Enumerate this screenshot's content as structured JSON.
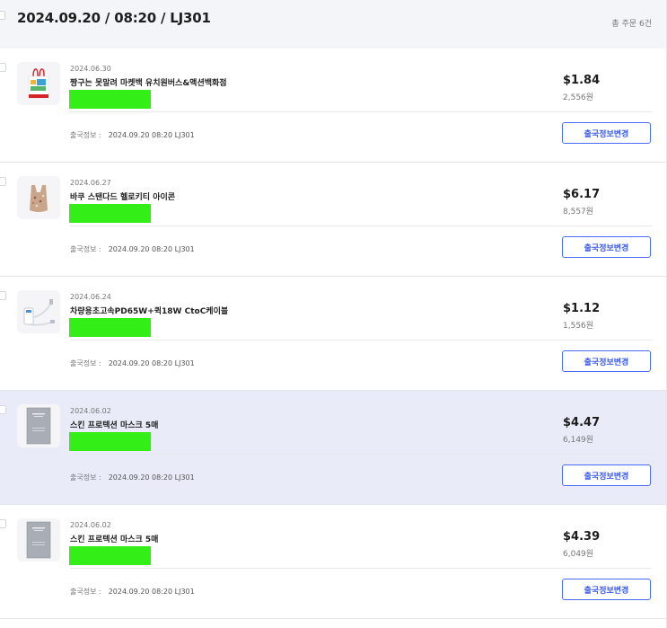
{
  "header": {
    "title": "2024.09.20 / 08:20 / LJ301",
    "total_orders": "총 주문 6건"
  },
  "ship_label": "출국정보 :",
  "ship_button_label": "출국정보변경",
  "items": [
    {
      "date": "2024.06.30",
      "name": "짱구는 못말려 마켓백 유치원버스&액션백화점",
      "price_usd": "$1.84",
      "price_krw": "2,556원",
      "ship_info": "2024.09.20 08:20 LJ301",
      "thumb_icon": "tote-bag-print-icon",
      "highlighted": false
    },
    {
      "date": "2024.06.27",
      "name": "바쿠 스탠다드 헬로키티 아이콘",
      "price_usd": "$6.17",
      "price_krw": "8,557원",
      "ship_info": "2024.09.20 08:20 LJ301",
      "thumb_icon": "shopping-bag-icon",
      "highlighted": false
    },
    {
      "date": "2024.06.24",
      "name": "차량용초고속PD65W+퀵18W CtoC케이블",
      "price_usd": "$1.12",
      "price_krw": "1,556원",
      "ship_info": "2024.09.20 08:20 LJ301",
      "thumb_icon": "car-charger-icon",
      "highlighted": false
    },
    {
      "date": "2024.06.02",
      "name": "스킨 프로텍션 마스크 5매",
      "price_usd": "$4.47",
      "price_krw": "6,149원",
      "ship_info": "2024.09.20 08:20 LJ301",
      "thumb_icon": "mask-pack-icon",
      "highlighted": true
    },
    {
      "date": "2024.06.02",
      "name": "스킨 프로텍션 마스크 5매",
      "price_usd": "$4.39",
      "price_krw": "6,049원",
      "ship_info": "2024.09.20 08:20 LJ301",
      "thumb_icon": "mask-pack-icon",
      "highlighted": false
    }
  ],
  "colors": {
    "header_bg": "#f4f5f9",
    "highlight_bg": "#e9ebf8",
    "button_border": "#4a6cf7",
    "redaction": "#33ee17"
  }
}
